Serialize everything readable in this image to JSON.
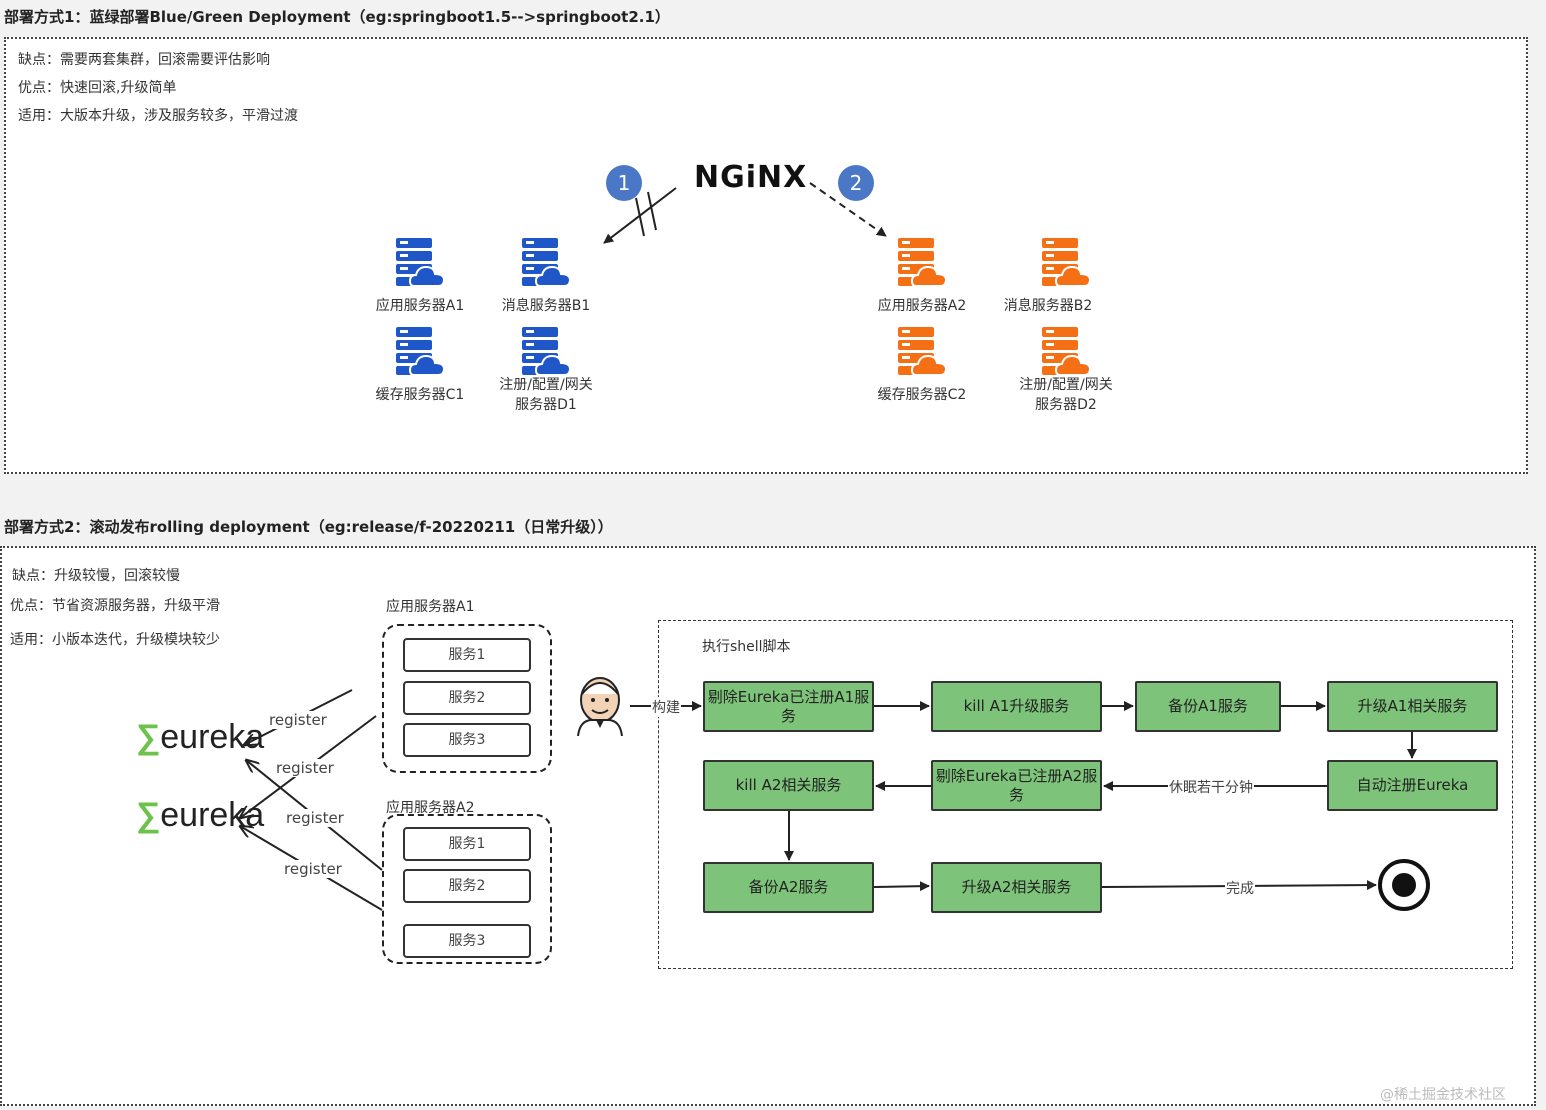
{
  "section1": {
    "title": "部署方式1：蓝绿部署Blue/Green Deployment（eg:springboot1.5-->springboot2.1）",
    "notes": [
      "缺点：需要两套集群，回滚需要评估影响",
      "优点：快速回滚,升级简单",
      "适用：大版本升级，涉及服务较多，平滑过渡"
    ],
    "nginx_label": "NGiNX",
    "badge1": "1",
    "badge2": "2",
    "blue_servers": [
      {
        "line1": "应用服务器A1",
        "line2": ""
      },
      {
        "line1": "消息服务器B1",
        "line2": ""
      },
      {
        "line1": "缓存服务器C1",
        "line2": ""
      },
      {
        "line1": "注册/配置/网关",
        "line2": "服务器D1"
      }
    ],
    "orange_servers": [
      {
        "line1": "应用服务器A2",
        "line2": ""
      },
      {
        "line1": "消息服务器B2",
        "line2": ""
      },
      {
        "line1": "缓存服务器C2",
        "line2": ""
      },
      {
        "line1": "注册/配置/网关",
        "line2": "服务器D2"
      }
    ],
    "colors": {
      "blue": "#1f56c8",
      "orange": "#f57014"
    }
  },
  "section2": {
    "title": "部署方式2：滚动发布rolling deployment（eg:release/f-20220211（日常升级））",
    "notes": [
      "缺点：升级较慢，回滚较慢",
      "优点：节省资源服务器，升级平滑",
      "适用：小版本迭代，升级模块较少"
    ],
    "eureka_text": "eureka",
    "eureka_symbol": "∑",
    "register_labels": [
      "register",
      "register",
      "register",
      "register"
    ],
    "groupA1": {
      "title": "应用服务器A1",
      "services": [
        "服务1",
        "服务2",
        "服务3"
      ]
    },
    "groupA2": {
      "title": "应用服务器A2",
      "services": [
        "服务1",
        "服务2",
        "服务3"
      ]
    },
    "build_label": "构建",
    "shell_title": "执行shell脚本",
    "steps": {
      "s1": "剔除Eureka已注册A1服务",
      "s2": "kill A1升级服务",
      "s3": "备份A1服务",
      "s4": "升级A1相关服务",
      "s5": "自动注册Eureka",
      "s6": "剔除Eureka已注册A2服务",
      "s7": "kill A2相关服务",
      "s8": "备份A2服务",
      "s9": "升级A2相关服务"
    },
    "sleep_label": "休眠若干分钟",
    "done_label": "完成",
    "step_color": "#7dc47a"
  },
  "watermark": "@稀土掘金技术社区"
}
